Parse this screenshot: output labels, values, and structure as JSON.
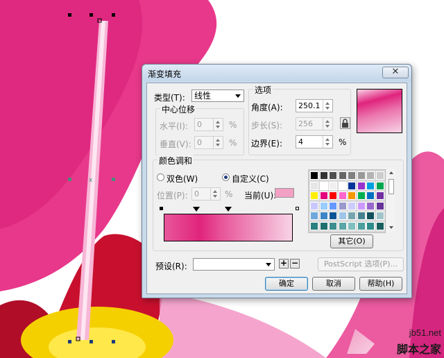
{
  "dialog": {
    "title": "渐变填充",
    "close_glyph": "✕",
    "type_label": "类型(T):",
    "type_value": "线性",
    "center_offset": {
      "title": "中心位移",
      "horizontal_label": "水平(I):",
      "horizontal_value": "0",
      "vertical_label": "垂直(V):",
      "vertical_value": "0",
      "unit": "%"
    },
    "options": {
      "title": "选项",
      "angle_label": "角度(A):",
      "angle_value": "250.1",
      "steps_label": "步长(S):",
      "steps_value": "256",
      "edge_label": "边界(E):",
      "edge_value": "4",
      "unit": "%"
    },
    "color_blend": {
      "title": "颜色调和",
      "two_color_label": "双色(W)",
      "custom_label": "自定义(C)",
      "selected_mode": "custom",
      "position_label": "位置(P):",
      "position_value": "0",
      "unit": "%",
      "current_label": "当前(U):",
      "current_color": "#f2a0c4",
      "other_button": "其它(O)"
    },
    "preset_label": "预设(R):",
    "preset_value": "",
    "postscript_button": "PostScript 选项(P)...",
    "ok_button": "确定",
    "cancel_button": "取消",
    "help_button": "帮助(H)"
  },
  "watermark": {
    "site": "jb51.net",
    "name": "脚本之家"
  },
  "colors": {
    "gradient_start": "#e0247d",
    "gradient_mid": "#e8569a",
    "gradient_end": "#f7d3e6",
    "petal_pink": "#e83d8d",
    "petal_red": "#c8102e",
    "center_yellow": "#f5d000"
  },
  "palette": [
    [
      "#000000",
      "#333333",
      "#4d4d4d",
      "#666666",
      "#808080",
      "#999999",
      "#b3b3b3",
      "#cccccc"
    ],
    [
      "#e6e6e6",
      "#ffffff",
      "#f0f0f0",
      "#ffffff",
      "#003399",
      "#9933cc",
      "#00a0e0",
      "#00a650"
    ],
    [
      "#ffee00",
      "#e6007e",
      "#ff0000",
      "#ff66cc",
      "#f39800",
      "#00b050",
      "#0070c0",
      "#7030a0"
    ],
    [
      "#c8c8ff",
      "#99ccff",
      "#6699ff",
      "#9999cc",
      "#ccccff",
      "#cc99ff",
      "#9966cc",
      "#663399"
    ],
    [
      "#6fa8dc",
      "#3d85c6",
      "#0b5394",
      "#9fc5e8",
      "#76a5af",
      "#45818e",
      "#134f5c",
      "#a2c4c9"
    ],
    [
      "#2a7f7f",
      "#1f6f6f",
      "#3c8d8d",
      "#5aa5a5",
      "#7fbfbf",
      "#4d9e9e",
      "#2e8b8b",
      "#1a6060"
    ]
  ]
}
